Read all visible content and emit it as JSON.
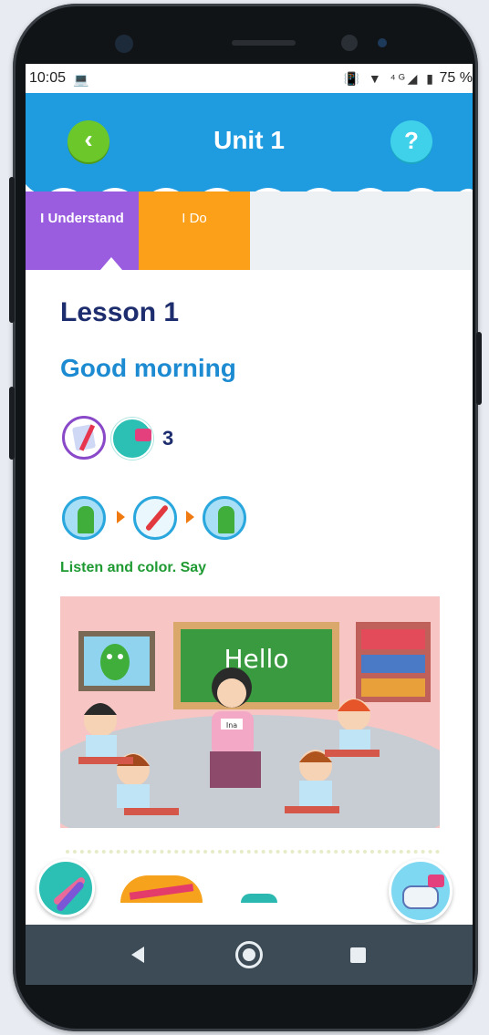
{
  "statusbar": {
    "time": "10:05",
    "icons": "📳 ▼ ⁴ᴳ◢ ▮",
    "battery": "75 %"
  },
  "header": {
    "back_icon": "chevron-left-icon",
    "title": "Unit 1",
    "help_label": "?"
  },
  "tabs": [
    {
      "label": "I Understand",
      "active": true
    },
    {
      "label": "I Do",
      "active": false
    }
  ],
  "lesson": {
    "title": "Lesson 1",
    "subtitle": "Good morning",
    "count": "3",
    "instruction": "Listen and color. Say"
  },
  "scene": {
    "board_text": "Hello",
    "name_tag": "Ina"
  },
  "colors": {
    "header_blue": "#1f9be0",
    "tab_purple": "#9a5de0",
    "tab_orange": "#fba018",
    "back_green": "#6cc72a",
    "help_cyan": "#3fd0ea",
    "title_navy": "#1d2d6e",
    "subtitle_blue": "#1d8bd1",
    "instruction_green": "#1f9a32"
  }
}
